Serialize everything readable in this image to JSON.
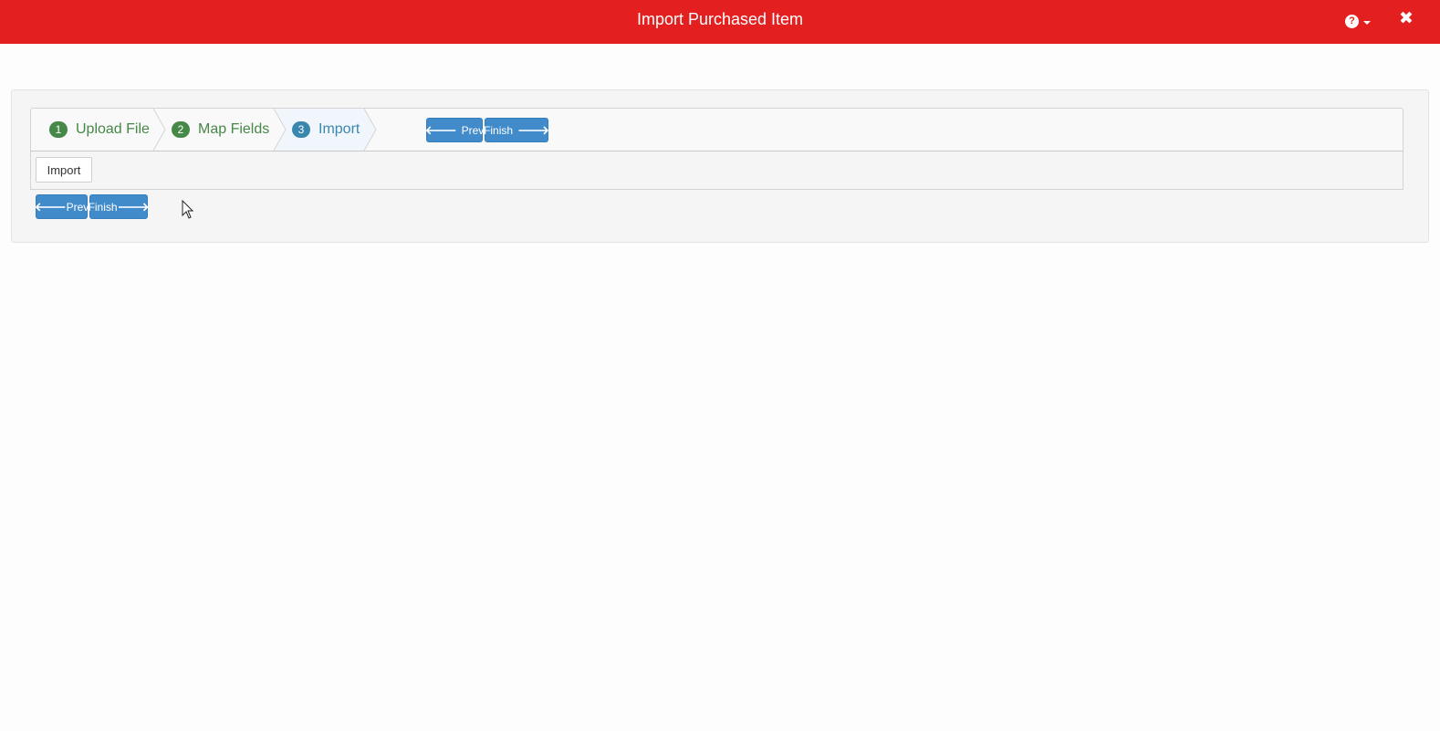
{
  "window": {
    "title": "Import Purchased Item",
    "help_glyph": "?",
    "close_glyph": "✖"
  },
  "wizard": {
    "steps": [
      {
        "number": "1",
        "label": "Upload File",
        "state": "done"
      },
      {
        "number": "2",
        "label": "Map Fields",
        "state": "done"
      },
      {
        "number": "3",
        "label": "Import",
        "state": "active"
      }
    ],
    "top_buttons": {
      "prev": "Prev",
      "finish": "Finish"
    },
    "content_label": "Import",
    "bottom_buttons": {
      "prev": "Prev",
      "finish": "Finish"
    }
  },
  "colors": {
    "header": "#e31f1f",
    "button": "#428bca",
    "step_done": "#468847",
    "step_active": "#3a87ad"
  },
  "icons": [
    "help-icon",
    "caret-down-icon",
    "close-icon",
    "arrow-left-icon",
    "arrow-right-icon"
  ]
}
